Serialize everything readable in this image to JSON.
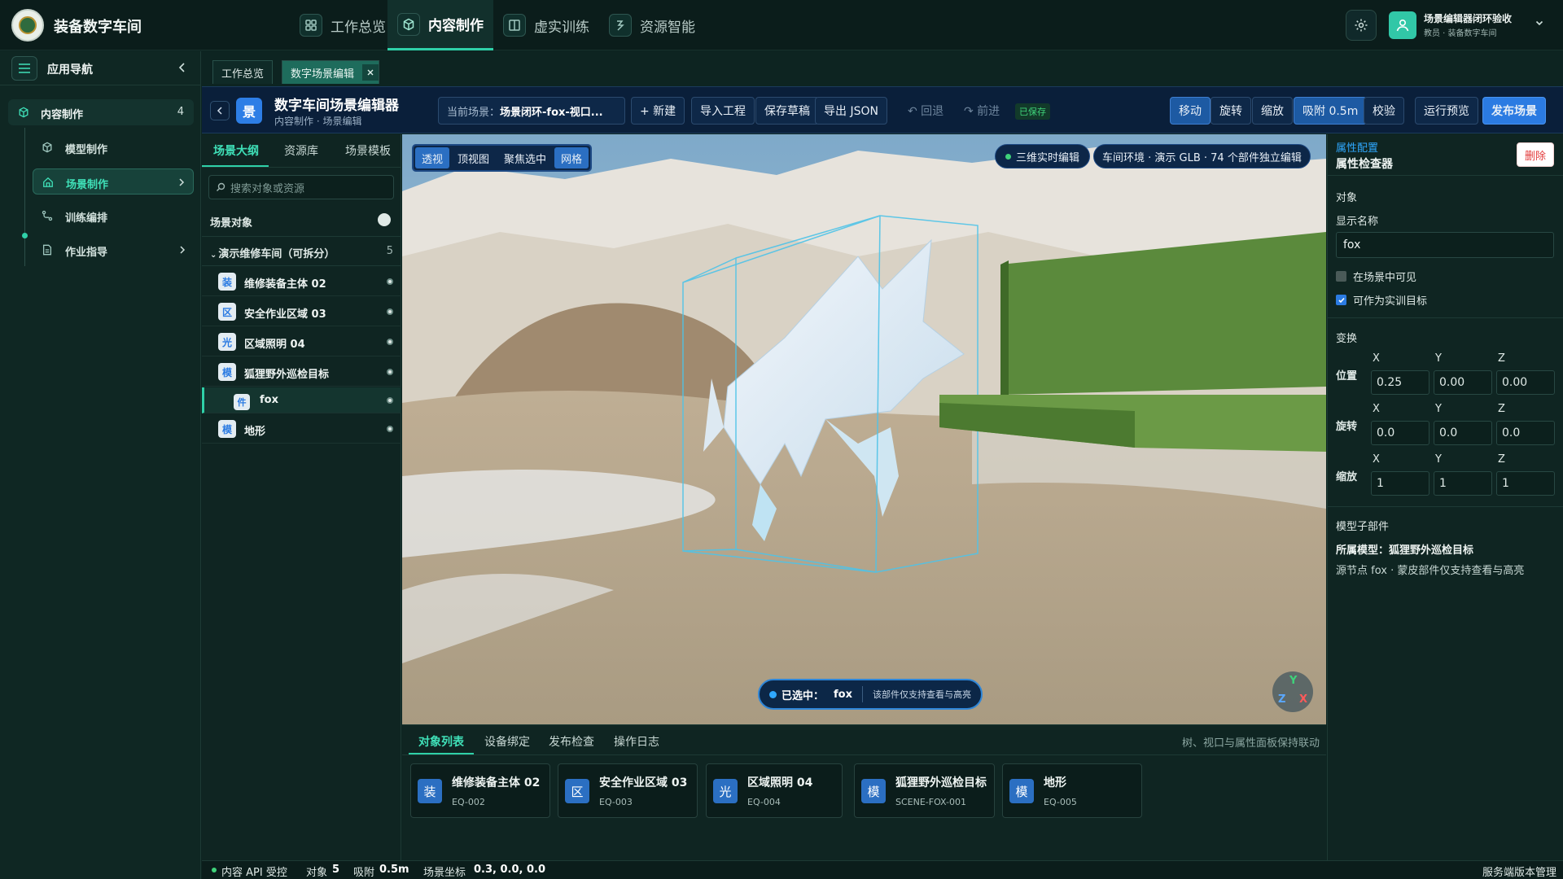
{
  "app": {
    "title": "装备数字车间"
  },
  "topnav": [
    {
      "label": "工作总览",
      "icon": "grid-icon"
    },
    {
      "label": "内容制作",
      "icon": "cube-icon",
      "active": true
    },
    {
      "label": "虚实训练",
      "icon": "book-icon"
    },
    {
      "label": "资源智能",
      "icon": "ai-icon"
    }
  ],
  "user": {
    "name": "场景编辑器闭环验收",
    "role": "教员 · 装备数字车间"
  },
  "leftnav": {
    "title": "应用导航",
    "group": {
      "label": "内容制作",
      "count": "4"
    },
    "items": [
      {
        "label": "模型制作",
        "icon": "cube-icon"
      },
      {
        "label": "场景制作",
        "icon": "home-icon",
        "active": true
      },
      {
        "label": "训练编排",
        "icon": "flow-icon"
      },
      {
        "label": "作业指导",
        "icon": "doc-icon"
      }
    ]
  },
  "doc_tabs": [
    {
      "label": "工作总览"
    },
    {
      "label": "数字场景编辑",
      "active": true
    }
  ],
  "editor": {
    "badge": "景",
    "title": "数字车间场景编辑器",
    "subtitle": "内容制作 · 场景编辑",
    "scene_label": "当前场景：",
    "scene_value": "场景闭环-fox-视口...",
    "buttons": {
      "new": "+ 新建",
      "import": "导入工程",
      "save_draft": "保存草稿",
      "export_json": "导出 JSON",
      "undo": "↶ 回退",
      "redo": "↷ 前进",
      "saved": "已保存",
      "move": "移动",
      "rotate": "旋转",
      "scale": "缩放",
      "snap": "吸附 0.5m",
      "validate": "校验",
      "preview": "运行预览",
      "publish": "发布场景"
    }
  },
  "outline": {
    "tabs": [
      "场景大纲",
      "资源库",
      "场景模板"
    ],
    "search_placeholder": "搜索对象或资源",
    "scene_objects": "场景对象",
    "group": {
      "label": "演示维修车间（可拆分）",
      "count": "5"
    },
    "rows": [
      {
        "badge": "装",
        "label": "维修装备主体 02"
      },
      {
        "badge": "区",
        "label": "安全作业区域 03"
      },
      {
        "badge": "光",
        "label": "区域照明 04"
      },
      {
        "badge": "模",
        "label": "狐狸野外巡检目标"
      },
      {
        "badge": "件",
        "label": "fox",
        "child": true,
        "selected": true
      },
      {
        "badge": "模",
        "label": "地形"
      }
    ]
  },
  "viewport": {
    "modes": [
      {
        "label": "透视",
        "on": true
      },
      {
        "label": "顶视图",
        "on": false
      },
      {
        "label": "聚焦选中",
        "on": false
      },
      {
        "label": "网格",
        "on": true
      }
    ],
    "live_chip": "三维实时编辑",
    "env_chip": "车间环境 · 演示 GLB · 74 个部件独立编辑",
    "selected_label": "已选中：",
    "selected_value": "fox",
    "selected_note": "该部件仅支持查看与高亮",
    "gizmo": {
      "y": "Y",
      "z": "Z",
      "x": "X"
    }
  },
  "bottom": {
    "tabs": [
      "对象列表",
      "设备绑定",
      "发布检查",
      "操作日志"
    ],
    "hint": "树、视口与属性面板保持联动",
    "cards": [
      {
        "badge": "装",
        "name": "维修装备主体 02",
        "code": "EQ-002"
      },
      {
        "badge": "区",
        "name": "安全作业区域 03",
        "code": "EQ-003"
      },
      {
        "badge": "光",
        "name": "区域照明 04",
        "code": "EQ-004"
      },
      {
        "badge": "模",
        "name": "狐狸野外巡检目标",
        "code": "SCENE-FOX-001"
      },
      {
        "badge": "模",
        "name": "地形",
        "code": "EQ-005"
      }
    ]
  },
  "inspector": {
    "kicker": "属性配置",
    "title": "属性检查器",
    "delete": "删除",
    "object_section": "对象",
    "display_name_label": "显示名称",
    "display_name_value": "fox",
    "visible_label": "在场景中可见",
    "visible_checked": false,
    "target_label": "可作为实训目标",
    "target_checked": true,
    "transform_section": "变换",
    "axes": [
      "X",
      "Y",
      "Z"
    ],
    "position_label": "位置",
    "position": [
      "0.25",
      "0.00",
      "0.00"
    ],
    "rotation_label": "旋转",
    "rotation": [
      "0.0",
      "0.0",
      "0.0"
    ],
    "scale_label": "缩放",
    "scale": [
      "1",
      "1",
      "1"
    ],
    "sub_section": "模型子部件",
    "sub_parent": "所属模型：狐狸野外巡检目标",
    "sub_note": "源节点 fox · 蒙皮部件仅支持查看与高亮"
  },
  "status": {
    "api": "内容 API 受控",
    "objects_label": "对象",
    "objects_value": "5",
    "snap_label": "吸附",
    "snap_value": "0.5m",
    "coord_label": "场景坐标",
    "coord_value": "0.3, 0.0, 0.0",
    "right": "服务端版本管理"
  },
  "colors": {
    "accent": "#2fd0a8",
    "primary": "#2b7be2",
    "danger": "#e23b3b"
  }
}
